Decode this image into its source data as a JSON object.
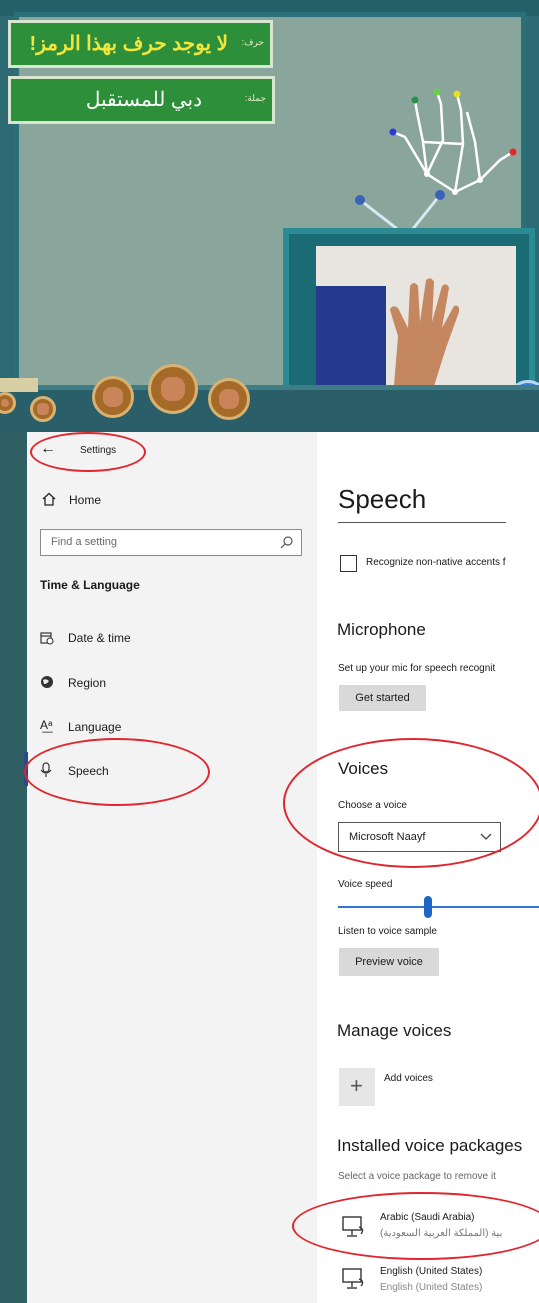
{
  "app": {
    "letter_label": "حرف:",
    "letter_value": "لا يوجد حرف بهذا الرمز!",
    "sentence_label": "جملة:",
    "sentence_value": "دبي للمستقبل"
  },
  "settings": {
    "back_label": "Settings",
    "nav": {
      "home": "Home",
      "search_placeholder": "Find a setting",
      "section_title": "Time & Language",
      "items": [
        {
          "label": "Date & time",
          "icon": "calendar-clock-icon"
        },
        {
          "label": "Region",
          "icon": "globe-icon"
        },
        {
          "label": "Language",
          "icon": "language-icon"
        },
        {
          "label": "Speech",
          "icon": "microphone-icon",
          "selected": true
        }
      ]
    },
    "main": {
      "title": "Speech",
      "recognize_checkbox_label": "Recognize non-native accents f",
      "microphone": {
        "heading": "Microphone",
        "description": "Set up your mic for speech recognit",
        "button": "Get started"
      },
      "voices": {
        "heading": "Voices",
        "choose_label": "Choose a voice",
        "selected_voice": "Microsoft Naayf",
        "speed_label": "Voice speed",
        "speed_value": 0.43,
        "listen_label": "Listen to voice sample",
        "preview_button": "Preview voice"
      },
      "manage": {
        "heading": "Manage voices",
        "add_label": "Add voices"
      },
      "installed": {
        "heading": "Installed voice packages",
        "description": "Select a voice package to remove it",
        "packages": [
          {
            "name": "Arabic (Saudi Arabia)",
            "native": "بية (المملكة العربية السعودية)"
          },
          {
            "name": "English (United States)",
            "native": "English (United States)"
          }
        ]
      }
    }
  },
  "colors": {
    "annotation_red": "#e0262e",
    "arabic_text_yellow": "#f3e63a",
    "label_green": "#2e8f3a",
    "slider_blue": "#1c67c5"
  }
}
